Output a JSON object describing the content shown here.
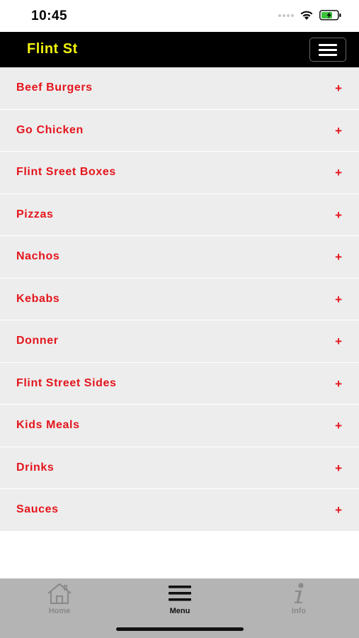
{
  "status_bar": {
    "time": "10:45"
  },
  "header": {
    "brand": "Flint St"
  },
  "categories": [
    {
      "label": "Beef Burgers"
    },
    {
      "label": "Go Chicken"
    },
    {
      "label": "Flint Sreet Boxes"
    },
    {
      "label": "Pizzas"
    },
    {
      "label": "Nachos"
    },
    {
      "label": "Kebabs"
    },
    {
      "label": "Donner"
    },
    {
      "label": "Flint Street Sides"
    },
    {
      "label": "Kids Meals"
    },
    {
      "label": "Drinks"
    },
    {
      "label": "Sauces"
    }
  ],
  "expand_symbol": "+",
  "bottom_nav": {
    "home": "Home",
    "menu": "Menu",
    "info": "Info"
  },
  "colors": {
    "header_bg": "#000000",
    "brand": "#f2f20f",
    "category_text": "#e4151c",
    "row_bg": "#ededed",
    "nav_bg": "#b4b4b4"
  }
}
